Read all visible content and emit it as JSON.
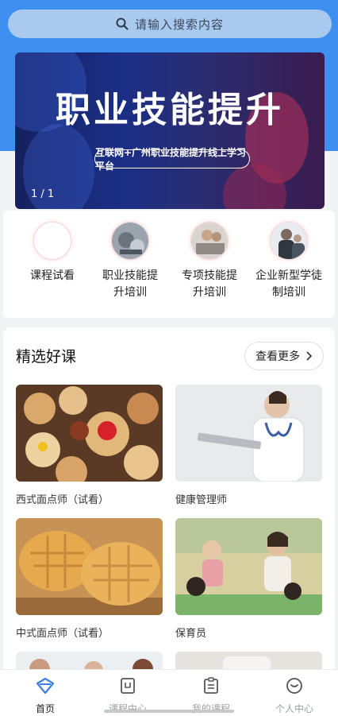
{
  "search": {
    "placeholder": "请输入搜索内容"
  },
  "banner": {
    "title": "职业技能提升",
    "subtitle": "互联网+广州职业技能提升线上学习平台",
    "counter": "1 / 1"
  },
  "categories": [
    {
      "label": "课程试看",
      "icon": "blank-circle-icon"
    },
    {
      "label": "职业技能提升培训",
      "icon": "vocational-skills-photo-icon"
    },
    {
      "label": "专项技能提升培训",
      "icon": "special-skills-photo-icon"
    },
    {
      "label": "企业新型学徒制培训",
      "icon": "apprentice-photo-icon"
    }
  ],
  "featured": {
    "title": "精选好课",
    "more_label": "查看更多",
    "courses": [
      {
        "name": "西式面点师（试看）",
        "image": "western-pastry-photo"
      },
      {
        "name": "健康管理师",
        "image": "doctor-photo"
      },
      {
        "name": "中式面点师（试看）",
        "image": "chinese-pastry-photo"
      },
      {
        "name": "保育员",
        "image": "childcare-photo"
      }
    ]
  },
  "tabbar": {
    "items": [
      {
        "label": "首页",
        "icon": "home-icon",
        "active": true
      },
      {
        "label": "课程中心",
        "icon": "course-center-icon",
        "active": false
      },
      {
        "label": "我的课程",
        "icon": "my-courses-icon",
        "active": false
      },
      {
        "label": "个人中心",
        "icon": "profile-icon",
        "active": false
      }
    ]
  },
  "colors": {
    "primary": "#3f8ff0",
    "search_bg": "#a9c9ee",
    "active_tab": "#3f7fe0"
  }
}
